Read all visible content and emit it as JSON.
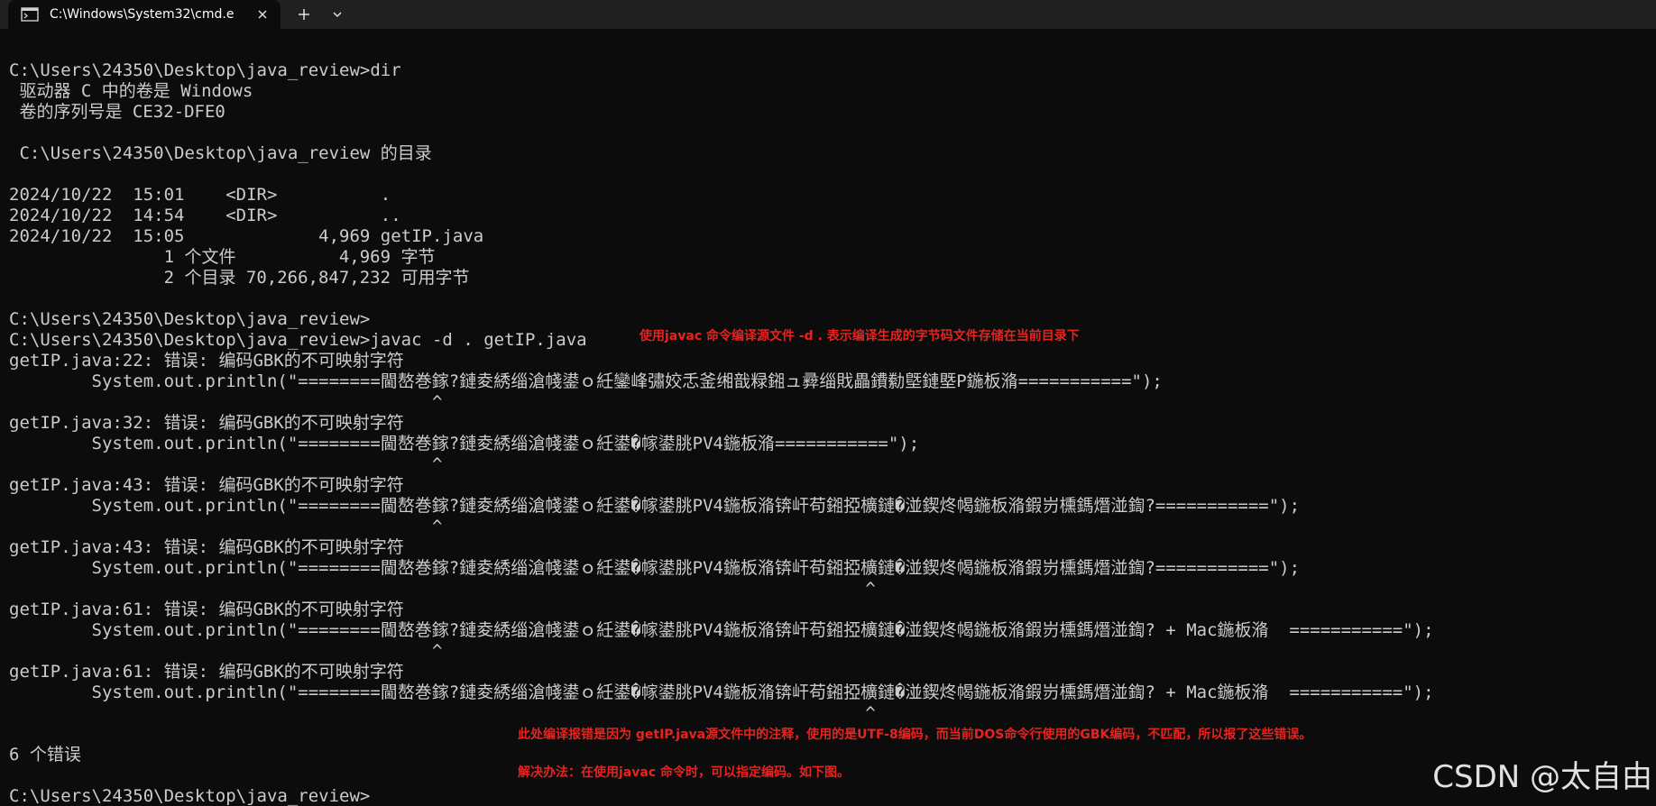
{
  "window": {
    "tab_title": "C:\\Windows\\System32\\cmd.e",
    "tab_icon": "terminal-icon",
    "close_icon": "close-icon",
    "new_tab_icon": "plus-icon",
    "dropdown_icon": "chevron-down-icon"
  },
  "terminal": {
    "lines": [
      "C:\\Users\\24350\\Desktop\\java_review>dir",
      " 驱动器 C 中的卷是 Windows",
      " 卷的序列号是 CE32-DFE0",
      "",
      " C:\\Users\\24350\\Desktop\\java_review 的目录",
      "",
      "2024/10/22  15:01    <DIR>          .",
      "2024/10/22  14:54    <DIR>          ..",
      "2024/10/22  15:05             4,969 getIP.java",
      "               1 个文件          4,969 字节",
      "               2 个目录 70,266,847,232 可用字节",
      "",
      "C:\\Users\\24350\\Desktop\\java_review>",
      "C:\\Users\\24350\\Desktop\\java_review>javac -d . getIP.java",
      "getIP.java:22: 错误: 编码GBK的不可映射字符",
      "        System.out.println(\"========閫嶅巻鎵?鏈夌綉缁滄帴鍙ｏ紝鑾峰彇姣忎釜缃戠粶鎺ュ彛缁戝畾鐨勬墍鏈塈P鍦板潃===========\");",
      "                                         ^",
      "getIP.java:32: 错误: 编码GBK的不可映射字符",
      "        System.out.println(\"========閫嶅巻鎵?鏈夌綉缁滄帴鍙ｏ紝鍙�幏鍙朓PV4鍦板潃===========\");",
      "                                         ^",
      "getIP.java:43: 错误: 编码GBK的不可映射字符",
      "        System.out.println(\"========閫嶅巻鎵?鏈夌綉缁滄帴鍙ｏ紝鍙�幏鍙朓PV4鍦板潃锛屽苟鎺掗櫎鏈�湴鍥炵幆鍦板潃鍜岃櫄鎷熸湴鍧?===========\");",
      "                                         ^",
      "getIP.java:43: 错误: 编码GBK的不可映射字符",
      "        System.out.println(\"========閫嶅巻鎵?鏈夌綉缁滄帴鍙ｏ紝鍙�幏鍙朓PV4鍦板潃锛屽苟鎺掗櫎鏈�湴鍥炵幆鍦板潃鍜岃櫄鎷熸湴鍧?===========\");",
      "                                                                                   ^",
      "getIP.java:61: 错误: 编码GBK的不可映射字符",
      "        System.out.println(\"========閫嶅巻鎵?鏈夌綉缁滄帴鍙ｏ紝鍙�幏鍙朓PV4鍦板潃锛屽苟鎺掗櫎鏈�湴鍥炵幆鍦板潃鍜岃櫄鎷熸湴鍧? + Mac鍦板潃  ===========\");",
      "                                         ^",
      "getIP.java:61: 错误: 编码GBK的不可映射字符",
      "        System.out.println(\"========閫嶅巻鎵?鏈夌綉缁滄帴鍙ｏ紝鍙�幏鍙朓PV4鍦板潃锛屽苟鎺掗櫎鏈�湴鍥炵幆鍦板潃鍜岃櫄鎷熸湴鍧? + Mac鍦板潃  ===========\");",
      "                                                                                   ^",
      "",
      "6 个错误",
      "",
      "C:\\Users\\24350\\Desktop\\java_review>"
    ]
  },
  "annotations": {
    "javac_note": "使用javac 命令编译源文件 -d . 表示编译生成的字节码文件存储在当前目录下",
    "error_reason": "此处编译报错是因为 getIP.java源文件中的注释，使用的是UTF-8编码，而当前DOS命令行使用的GBK编码，不匹配，所以报了这些错误。",
    "solution": "解决办法：在使用javac 命令时，可以指定编码。如下图。"
  },
  "watermark": "CSDN @太自由",
  "colors": {
    "background": "#0c0c0c",
    "text": "#cccccc",
    "tabbar": "#202020",
    "annotation": "#e8231f"
  }
}
